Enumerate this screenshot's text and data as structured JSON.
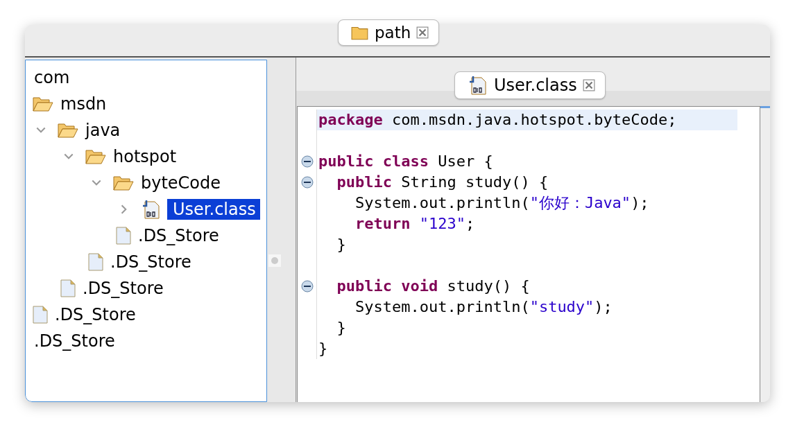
{
  "top_tab": {
    "label": "path"
  },
  "tree": [
    {
      "label": "com",
      "kind": "text"
    },
    {
      "label": "msdn",
      "kind": "folder",
      "children": [
        {
          "label": "java",
          "kind": "folder",
          "expanded": true,
          "children": [
            {
              "label": "hotspot",
              "kind": "folder",
              "expanded": true,
              "children": [
                {
                  "label": "byteCode",
                  "kind": "folder",
                  "expanded": true,
                  "children": [
                    {
                      "label": "User.class",
                      "kind": "class",
                      "expanded": false,
                      "selected": true
                    },
                    {
                      "label": ".DS_Store",
                      "kind": "file",
                      "selected": false
                    }
                  ]
                },
                {
                  "label": ".DS_Store",
                  "kind": "file",
                  "selected": false
                }
              ]
            },
            {
              "label": ".DS_Store",
              "kind": "file",
              "selected": false
            }
          ]
        },
        {
          "label": ".DS_Store",
          "kind": "file",
          "selected": false
        }
      ]
    },
    {
      "label": ".DS_Store",
      "kind": "text"
    }
  ],
  "editor_tab": {
    "label": "User.class"
  },
  "code": [
    {
      "current": true,
      "fold": false,
      "tokens": [
        {
          "kind": "keyword",
          "text": "package"
        },
        {
          "kind": "plain",
          "text": " com.msdn.java.hotspot.byteCode;"
        }
      ]
    },
    {
      "current": false,
      "fold": false
    },
    {
      "current": false,
      "fold": true,
      "tokens": [
        {
          "kind": "keyword",
          "text": "public class"
        },
        {
          "kind": "plain",
          "text": " User {"
        }
      ]
    },
    {
      "current": false,
      "fold": true,
      "tokens": [
        {
          "kind": "keyword",
          "text": "  public"
        },
        {
          "kind": "plain",
          "text": " String study() {"
        }
      ]
    },
    {
      "current": false,
      "fold": false,
      "tokens": [
        {
          "kind": "plain",
          "text": "    System.out.println("
        },
        {
          "kind": "string",
          "text": "\"你好：Java\""
        },
        {
          "kind": "plain",
          "text": ");"
        }
      ]
    },
    {
      "current": false,
      "fold": false,
      "tokens": [
        {
          "kind": "keyword",
          "text": "    return"
        },
        {
          "kind": "string",
          "text": " \"123\""
        },
        {
          "kind": "plain",
          "text": ";"
        }
      ]
    },
    {
      "current": false,
      "fold": false,
      "tokens": [
        {
          "kind": "plain",
          "text": "  }"
        }
      ]
    },
    {
      "current": false,
      "fold": false
    },
    {
      "current": false,
      "fold": true,
      "tokens": [
        {
          "kind": "keyword",
          "text": "  public void"
        },
        {
          "kind": "plain",
          "text": " study() {"
        }
      ]
    },
    {
      "current": false,
      "fold": false,
      "tokens": [
        {
          "kind": "plain",
          "text": "    System.out.println("
        },
        {
          "kind": "string",
          "text": "\"study\""
        },
        {
          "kind": "plain",
          "text": ");"
        }
      ]
    },
    {
      "current": false,
      "fold": false,
      "tokens": [
        {
          "kind": "plain",
          "text": "  }"
        }
      ]
    },
    {
      "current": false,
      "fold": false,
      "tokens": [
        {
          "kind": "plain",
          "text": "}"
        }
      ]
    }
  ]
}
